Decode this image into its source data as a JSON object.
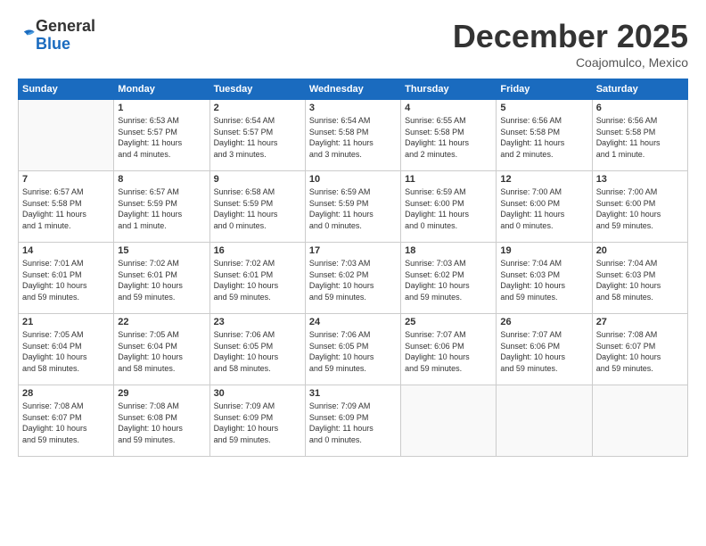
{
  "logo": {
    "general": "General",
    "blue": "Blue"
  },
  "header": {
    "month": "December 2025",
    "location": "Coajomulco, Mexico"
  },
  "weekdays": [
    "Sunday",
    "Monday",
    "Tuesday",
    "Wednesday",
    "Thursday",
    "Friday",
    "Saturday"
  ],
  "weeks": [
    [
      {
        "day": "",
        "info": ""
      },
      {
        "day": "1",
        "info": "Sunrise: 6:53 AM\nSunset: 5:57 PM\nDaylight: 11 hours\nand 4 minutes."
      },
      {
        "day": "2",
        "info": "Sunrise: 6:54 AM\nSunset: 5:57 PM\nDaylight: 11 hours\nand 3 minutes."
      },
      {
        "day": "3",
        "info": "Sunrise: 6:54 AM\nSunset: 5:58 PM\nDaylight: 11 hours\nand 3 minutes."
      },
      {
        "day": "4",
        "info": "Sunrise: 6:55 AM\nSunset: 5:58 PM\nDaylight: 11 hours\nand 2 minutes."
      },
      {
        "day": "5",
        "info": "Sunrise: 6:56 AM\nSunset: 5:58 PM\nDaylight: 11 hours\nand 2 minutes."
      },
      {
        "day": "6",
        "info": "Sunrise: 6:56 AM\nSunset: 5:58 PM\nDaylight: 11 hours\nand 1 minute."
      }
    ],
    [
      {
        "day": "7",
        "info": "Sunrise: 6:57 AM\nSunset: 5:58 PM\nDaylight: 11 hours\nand 1 minute."
      },
      {
        "day": "8",
        "info": "Sunrise: 6:57 AM\nSunset: 5:59 PM\nDaylight: 11 hours\nand 1 minute."
      },
      {
        "day": "9",
        "info": "Sunrise: 6:58 AM\nSunset: 5:59 PM\nDaylight: 11 hours\nand 0 minutes."
      },
      {
        "day": "10",
        "info": "Sunrise: 6:59 AM\nSunset: 5:59 PM\nDaylight: 11 hours\nand 0 minutes."
      },
      {
        "day": "11",
        "info": "Sunrise: 6:59 AM\nSunset: 6:00 PM\nDaylight: 11 hours\nand 0 minutes."
      },
      {
        "day": "12",
        "info": "Sunrise: 7:00 AM\nSunset: 6:00 PM\nDaylight: 11 hours\nand 0 minutes."
      },
      {
        "day": "13",
        "info": "Sunrise: 7:00 AM\nSunset: 6:00 PM\nDaylight: 10 hours\nand 59 minutes."
      }
    ],
    [
      {
        "day": "14",
        "info": "Sunrise: 7:01 AM\nSunset: 6:01 PM\nDaylight: 10 hours\nand 59 minutes."
      },
      {
        "day": "15",
        "info": "Sunrise: 7:02 AM\nSunset: 6:01 PM\nDaylight: 10 hours\nand 59 minutes."
      },
      {
        "day": "16",
        "info": "Sunrise: 7:02 AM\nSunset: 6:01 PM\nDaylight: 10 hours\nand 59 minutes."
      },
      {
        "day": "17",
        "info": "Sunrise: 7:03 AM\nSunset: 6:02 PM\nDaylight: 10 hours\nand 59 minutes."
      },
      {
        "day": "18",
        "info": "Sunrise: 7:03 AM\nSunset: 6:02 PM\nDaylight: 10 hours\nand 59 minutes."
      },
      {
        "day": "19",
        "info": "Sunrise: 7:04 AM\nSunset: 6:03 PM\nDaylight: 10 hours\nand 59 minutes."
      },
      {
        "day": "20",
        "info": "Sunrise: 7:04 AM\nSunset: 6:03 PM\nDaylight: 10 hours\nand 58 minutes."
      }
    ],
    [
      {
        "day": "21",
        "info": "Sunrise: 7:05 AM\nSunset: 6:04 PM\nDaylight: 10 hours\nand 58 minutes."
      },
      {
        "day": "22",
        "info": "Sunrise: 7:05 AM\nSunset: 6:04 PM\nDaylight: 10 hours\nand 58 minutes."
      },
      {
        "day": "23",
        "info": "Sunrise: 7:06 AM\nSunset: 6:05 PM\nDaylight: 10 hours\nand 58 minutes."
      },
      {
        "day": "24",
        "info": "Sunrise: 7:06 AM\nSunset: 6:05 PM\nDaylight: 10 hours\nand 59 minutes."
      },
      {
        "day": "25",
        "info": "Sunrise: 7:07 AM\nSunset: 6:06 PM\nDaylight: 10 hours\nand 59 minutes."
      },
      {
        "day": "26",
        "info": "Sunrise: 7:07 AM\nSunset: 6:06 PM\nDaylight: 10 hours\nand 59 minutes."
      },
      {
        "day": "27",
        "info": "Sunrise: 7:08 AM\nSunset: 6:07 PM\nDaylight: 10 hours\nand 59 minutes."
      }
    ],
    [
      {
        "day": "28",
        "info": "Sunrise: 7:08 AM\nSunset: 6:07 PM\nDaylight: 10 hours\nand 59 minutes."
      },
      {
        "day": "29",
        "info": "Sunrise: 7:08 AM\nSunset: 6:08 PM\nDaylight: 10 hours\nand 59 minutes."
      },
      {
        "day": "30",
        "info": "Sunrise: 7:09 AM\nSunset: 6:09 PM\nDaylight: 10 hours\nand 59 minutes."
      },
      {
        "day": "31",
        "info": "Sunrise: 7:09 AM\nSunset: 6:09 PM\nDaylight: 11 hours\nand 0 minutes."
      },
      {
        "day": "",
        "info": ""
      },
      {
        "day": "",
        "info": ""
      },
      {
        "day": "",
        "info": ""
      }
    ]
  ]
}
